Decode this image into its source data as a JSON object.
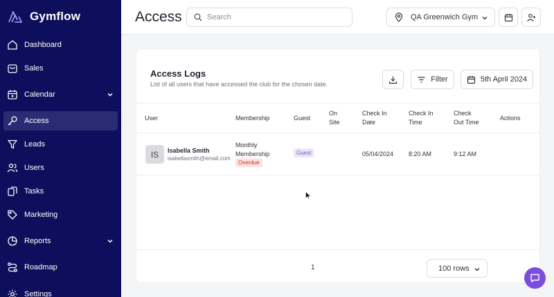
{
  "brand": {
    "name": "Gymflow"
  },
  "sidebar": {
    "items": [
      {
        "label": "Dashboard",
        "icon": "home-icon"
      },
      {
        "label": "Sales",
        "icon": "bag-icon"
      },
      {
        "label": "Calendar",
        "icon": "calendar-icon",
        "expandable": true
      },
      {
        "label": "Access",
        "icon": "key-icon",
        "active": true
      },
      {
        "label": "Leads",
        "icon": "funnel-icon"
      },
      {
        "label": "Users",
        "icon": "users-icon"
      },
      {
        "label": "Tasks",
        "icon": "tasks-icon"
      },
      {
        "label": "Marketing",
        "icon": "tag-icon"
      },
      {
        "label": "Reports",
        "icon": "pie-chart-icon",
        "expandable": true
      },
      {
        "label": "Roadmap",
        "icon": "route-icon"
      },
      {
        "label": "Settings",
        "icon": "gear-icon"
      }
    ]
  },
  "header": {
    "title": "Access",
    "search_placeholder": "Search",
    "gym_selected": "QA Greenwich Gym"
  },
  "access_logs": {
    "title": "Access Logs",
    "subtitle": "List of all users that have accessed the club for the chosen date.",
    "filter_label": "Filter",
    "date_label": "5th April 2024",
    "columns": [
      "User",
      "Membership",
      "Guest",
      "On Site",
      "Check In Date",
      "Check In Time",
      "Check Out Time",
      "Actions"
    ],
    "columns_display": {
      "user": "User",
      "membership": "Membership",
      "guest": "Guest",
      "onsite_1": "On",
      "onsite_2": "Site",
      "checkin_date_1": "Check In",
      "checkin_date_2": "Date",
      "checkin_time_1": "Check In",
      "checkin_time_2": "Time",
      "checkout_time_1": "Check",
      "checkout_time_2": "Out Time",
      "actions": "Actions"
    },
    "rows": [
      {
        "initials": "IS",
        "name": "Isabella Smith",
        "email": "isabellasmith@email.com",
        "membership_1": "Monthly",
        "membership_2": "Membership",
        "membership_status": "Overdue",
        "guest": "Guest",
        "check_in_date": "05/04/2024",
        "check_in_time": "8:20 AM",
        "check_out_time": "9:12 AM"
      }
    ],
    "pagination": {
      "page": "1",
      "rows_per_page": "100 rows"
    }
  },
  "colors": {
    "sidebar_bg": "#0e0f5c",
    "sidebar_active": "#2a2c73",
    "accent": "#7c4ddc",
    "overdue_bg": "#fde2e1",
    "overdue_text": "#c0392b",
    "guest_bg": "#ebe4f7",
    "guest_text": "#7c5bb5"
  }
}
